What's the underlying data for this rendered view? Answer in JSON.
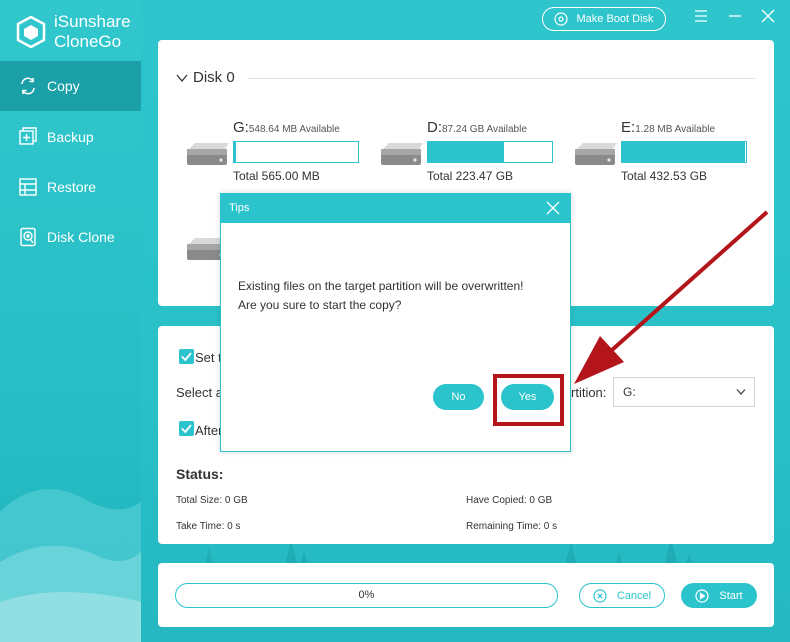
{
  "brand": {
    "line1": "iSunshare",
    "line2": "CloneGo"
  },
  "sidebar": {
    "items": [
      {
        "label": "Copy",
        "icon": "copy-icon",
        "active": true
      },
      {
        "label": "Backup",
        "icon": "backup-icon",
        "active": false
      },
      {
        "label": "Restore",
        "icon": "restore-icon",
        "active": false
      },
      {
        "label": "Disk Clone",
        "icon": "disk-clone-icon",
        "active": false
      }
    ]
  },
  "topbar": {
    "boot_label": "Make Boot Disk"
  },
  "disk": {
    "title": "Disk 0",
    "partitions": [
      {
        "letter": "G:",
        "available": "548.64 MB Available",
        "total": "Total 565.00 MB",
        "used_fraction": 0.02
      },
      {
        "letter": "D:",
        "available": "87.24 GB Available",
        "total": "Total 223.47 GB",
        "used_fraction": 0.61
      },
      {
        "letter": "E:",
        "available": "1.28 MB Available",
        "total": "Total 432.53 GB",
        "used_fraction": 0.99
      }
    ]
  },
  "options": {
    "set_partial": "Set t",
    "select_partial": "Select a",
    "partition_label_partial": "rtition:",
    "partition_value": "G:",
    "after_partial": "After"
  },
  "status": {
    "title": "Status:",
    "total_size": "Total Size: 0 GB",
    "have_copied": "Have Copied: 0 GB",
    "take_time": "Take Time: 0 s",
    "remaining_time": "Remaining Time: 0 s"
  },
  "bottom": {
    "progress_text": "0%",
    "progress_value": 0,
    "cancel_label": "Cancel",
    "start_label": "Start"
  },
  "dialog": {
    "title": "Tips",
    "line1": "Existing files on the target partition will be overwritten!",
    "line2": "Are you sure to start the copy?",
    "no_label": "No",
    "yes_label": "Yes"
  },
  "colors": {
    "accent": "#2cc4cc",
    "sidebar_active": "#1ba0a8",
    "annotation": "#b3151b"
  }
}
